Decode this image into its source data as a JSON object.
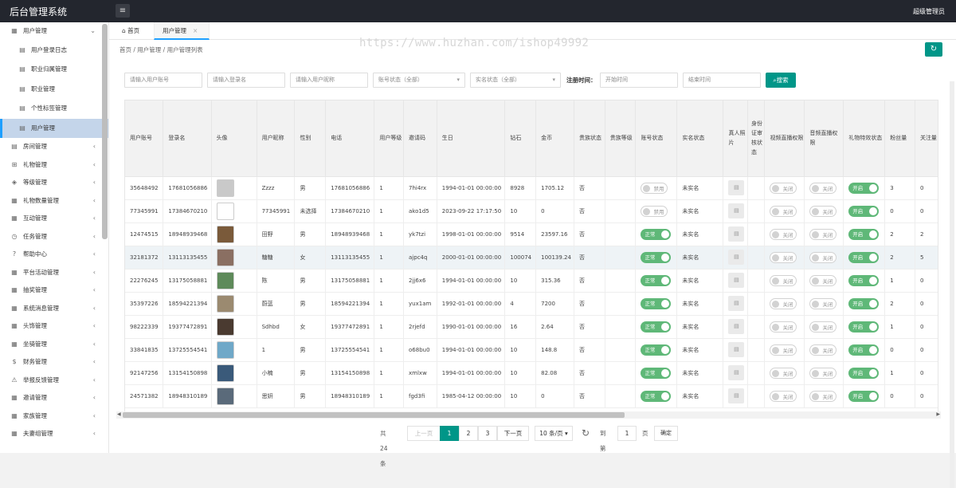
{
  "app": {
    "title": "后台管理系统",
    "admin_label": "超级管理员"
  },
  "sidebar": {
    "items": [
      {
        "label": "用户管理",
        "icon": "grid-icon",
        "arrow": "⌄",
        "sub": false
      },
      {
        "label": "用户登录日志",
        "icon": "doc-icon",
        "sub": true
      },
      {
        "label": "职业归属管理",
        "icon": "doc-icon",
        "sub": true
      },
      {
        "label": "职业管理",
        "icon": "doc-icon",
        "sub": true
      },
      {
        "label": "个性标签管理",
        "icon": "doc-icon",
        "sub": true
      },
      {
        "label": "用户管理",
        "icon": "doc-icon",
        "sub": true,
        "active": true
      },
      {
        "label": "房间管理",
        "icon": "doc-icon",
        "arrow": "‹"
      },
      {
        "label": "礼物管理",
        "icon": "gift-icon",
        "arrow": "‹"
      },
      {
        "label": "等级管理",
        "icon": "diamond-icon",
        "arrow": "‹"
      },
      {
        "label": "礼物数量管理",
        "icon": "grid-icon",
        "arrow": "‹"
      },
      {
        "label": "互动管理",
        "icon": "grid-icon",
        "arrow": "‹"
      },
      {
        "label": "任务管理",
        "icon": "clock-icon",
        "arrow": "‹"
      },
      {
        "label": "帮助中心",
        "icon": "help-icon",
        "arrow": "‹"
      },
      {
        "label": "平台活动管理",
        "icon": "grid-icon",
        "arrow": "‹"
      },
      {
        "label": "抽奖管理",
        "icon": "grid-icon",
        "arrow": "‹"
      },
      {
        "label": "系统消息管理",
        "icon": "grid-icon",
        "arrow": "‹"
      },
      {
        "label": "头饰管理",
        "icon": "grid-icon",
        "arrow": "‹"
      },
      {
        "label": "坐骑管理",
        "icon": "grid-icon",
        "arrow": "‹"
      },
      {
        "label": "财务管理",
        "icon": "dollar-icon",
        "arrow": "‹"
      },
      {
        "label": "举报反馈管理",
        "icon": "warning-icon",
        "arrow": "‹"
      },
      {
        "label": "邀请管理",
        "icon": "grid-icon",
        "arrow": "‹"
      },
      {
        "label": "家族管理",
        "icon": "grid-icon",
        "arrow": "‹"
      },
      {
        "label": "夫妻组管理",
        "icon": "grid-icon",
        "arrow": "‹"
      }
    ]
  },
  "tabs": {
    "home": "首页",
    "user": "用户管理",
    "close": "×"
  },
  "breadcrumb": "首页 / 用户管理 / 用户管理列表",
  "watermark": "https://www.huzhan.com/ishop49992",
  "filters": {
    "account_placeholder": "请输入用户账号",
    "login_placeholder": "请输入登录名",
    "nickname_placeholder": "请输入用户昵称",
    "account_status": "账号状态（全部）",
    "realname_status": "实名状态（全部）",
    "register_label": "注册时间：",
    "start_placeholder": "开始时间",
    "end_placeholder": "结束时间",
    "search_label": "搜索"
  },
  "table": {
    "headers": [
      "用户账号",
      "登录名",
      "头像",
      "用户昵称",
      "性别",
      "电话",
      "用户等级",
      "邀请码",
      "生日",
      "钻石",
      "金币",
      "贵族状态",
      "贵族等级",
      "账号状态",
      "实名状态",
      "真人照片",
      "身份证审核状态",
      "视频直播权限",
      "音频直播权限",
      "礼物特效状态",
      "粉丝量",
      "关注量"
    ],
    "rows": [
      {
        "account": "35648492",
        "login": "17681056886",
        "avatar": "#c9c9c9",
        "nick": "Zzzz",
        "gender": "男",
        "phone": "17681056886",
        "level": "1",
        "invite": "7hi4rx",
        "birthday": "1994-01-01 00:00:00",
        "diamond": "8928",
        "gold": "1705.12",
        "noble": "否",
        "noble_level": "",
        "status": "禁用",
        "status_on": false,
        "realname": "未实名",
        "video": "关闭",
        "audio": "关闭",
        "gift": "开启",
        "fans": "3",
        "follow": "0"
      },
      {
        "account": "77345991",
        "login": "17384670210",
        "avatar": "#ffffff",
        "nick": "77345991",
        "gender": "未选择",
        "phone": "17384670210",
        "level": "1",
        "invite": "ako1d5",
        "birthday": "2023-09-22 17:17:50",
        "diamond": "10",
        "gold": "0",
        "noble": "否",
        "noble_level": "",
        "status": "禁用",
        "status_on": false,
        "realname": "未实名",
        "video": "关闭",
        "audio": "关闭",
        "gift": "开启",
        "fans": "0",
        "follow": "0"
      },
      {
        "account": "12474515",
        "login": "18948939468",
        "avatar": "#7a5a3a",
        "nick": "田野",
        "gender": "男",
        "phone": "18948939468",
        "level": "1",
        "invite": "yk7tzi",
        "birthday": "1998-01-01 00:00:00",
        "diamond": "9514",
        "gold": "23597.16",
        "noble": "否",
        "noble_level": "",
        "status": "正常",
        "status_on": true,
        "realname": "未实名",
        "video": "关闭",
        "audio": "关闭",
        "gift": "开启",
        "fans": "2",
        "follow": "2"
      },
      {
        "account": "32181372",
        "login": "13113135455",
        "avatar": "#8a6f62",
        "nick": "糖糖",
        "gender": "女",
        "phone": "13113135455",
        "level": "1",
        "invite": "ajpc4q",
        "birthday": "2000-01-01 00:00:00",
        "diamond": "100074",
        "gold": "100139.24",
        "noble": "否",
        "noble_level": "",
        "status": "正常",
        "status_on": true,
        "realname": "未实名",
        "video": "关闭",
        "audio": "关闭",
        "gift": "开启",
        "fans": "2",
        "follow": "5",
        "hl": true
      },
      {
        "account": "22276245",
        "login": "13175058881",
        "avatar": "#5e8a5a",
        "nick": "陈",
        "gender": "男",
        "phone": "13175058881",
        "level": "1",
        "invite": "2jj6x6",
        "birthday": "1994-01-01 00:00:00",
        "diamond": "10",
        "gold": "315.36",
        "noble": "否",
        "noble_level": "",
        "status": "正常",
        "status_on": true,
        "realname": "未实名",
        "video": "关闭",
        "audio": "关闭",
        "gift": "开启",
        "fans": "1",
        "follow": "0"
      },
      {
        "account": "35397226",
        "login": "18594221394",
        "avatar": "#9b8a70",
        "nick": "蔚蓝",
        "gender": "男",
        "phone": "18594221394",
        "level": "1",
        "invite": "yux1am",
        "birthday": "1992-01-01 00:00:00",
        "diamond": "4",
        "gold": "7200",
        "noble": "否",
        "noble_level": "",
        "status": "正常",
        "status_on": true,
        "realname": "未实名",
        "video": "关闭",
        "audio": "关闭",
        "gift": "开启",
        "fans": "2",
        "follow": "0"
      },
      {
        "account": "98222339",
        "login": "19377472891",
        "avatar": "#4a3a30",
        "nick": "Sdhbd",
        "gender": "女",
        "phone": "19377472891",
        "level": "1",
        "invite": "2rjefd",
        "birthday": "1990-01-01 00:00:00",
        "diamond": "16",
        "gold": "2.64",
        "noble": "否",
        "noble_level": "",
        "status": "正常",
        "status_on": true,
        "realname": "未实名",
        "video": "关闭",
        "audio": "关闭",
        "gift": "开启",
        "fans": "1",
        "follow": "0"
      },
      {
        "account": "33841835",
        "login": "13725554541",
        "avatar": "#6fa8c8",
        "nick": "1",
        "gender": "男",
        "phone": "13725554541",
        "level": "1",
        "invite": "o68bu0",
        "birthday": "1994-01-01 00:00:00",
        "diamond": "10",
        "gold": "148.8",
        "noble": "否",
        "noble_level": "",
        "status": "正常",
        "status_on": true,
        "realname": "未实名",
        "video": "关闭",
        "audio": "关闭",
        "gift": "开启",
        "fans": "0",
        "follow": "0"
      },
      {
        "account": "92147256",
        "login": "13154150898",
        "avatar": "#3a5a7a",
        "nick": "小楠",
        "gender": "男",
        "phone": "13154150898",
        "level": "1",
        "invite": "xmlxw",
        "birthday": "1994-01-01 00:00:00",
        "diamond": "10",
        "gold": "82.08",
        "noble": "否",
        "noble_level": "",
        "status": "正常",
        "status_on": true,
        "realname": "未实名",
        "video": "关闭",
        "audio": "关闭",
        "gift": "开启",
        "fans": "1",
        "follow": "0"
      },
      {
        "account": "24571382",
        "login": "18948310189",
        "avatar": "#5a6a7a",
        "nick": "思妍",
        "gender": "男",
        "phone": "18948310189",
        "level": "1",
        "invite": "fgd3fi",
        "birthday": "1985-04-12 00:00:00",
        "diamond": "10",
        "gold": "0",
        "noble": "否",
        "noble_level": "",
        "status": "正常",
        "status_on": true,
        "realname": "未实名",
        "video": "关闭",
        "audio": "关闭",
        "gift": "开启",
        "fans": "0",
        "follow": "0"
      }
    ]
  },
  "pagination": {
    "total": "共 24 条",
    "prev": "上一页",
    "pages": [
      "1",
      "2",
      "3"
    ],
    "next": "下一页",
    "per_page": "10 条/页",
    "goto": "到第",
    "goto_value": "1",
    "page_unit": "页",
    "confirm": "确定"
  }
}
